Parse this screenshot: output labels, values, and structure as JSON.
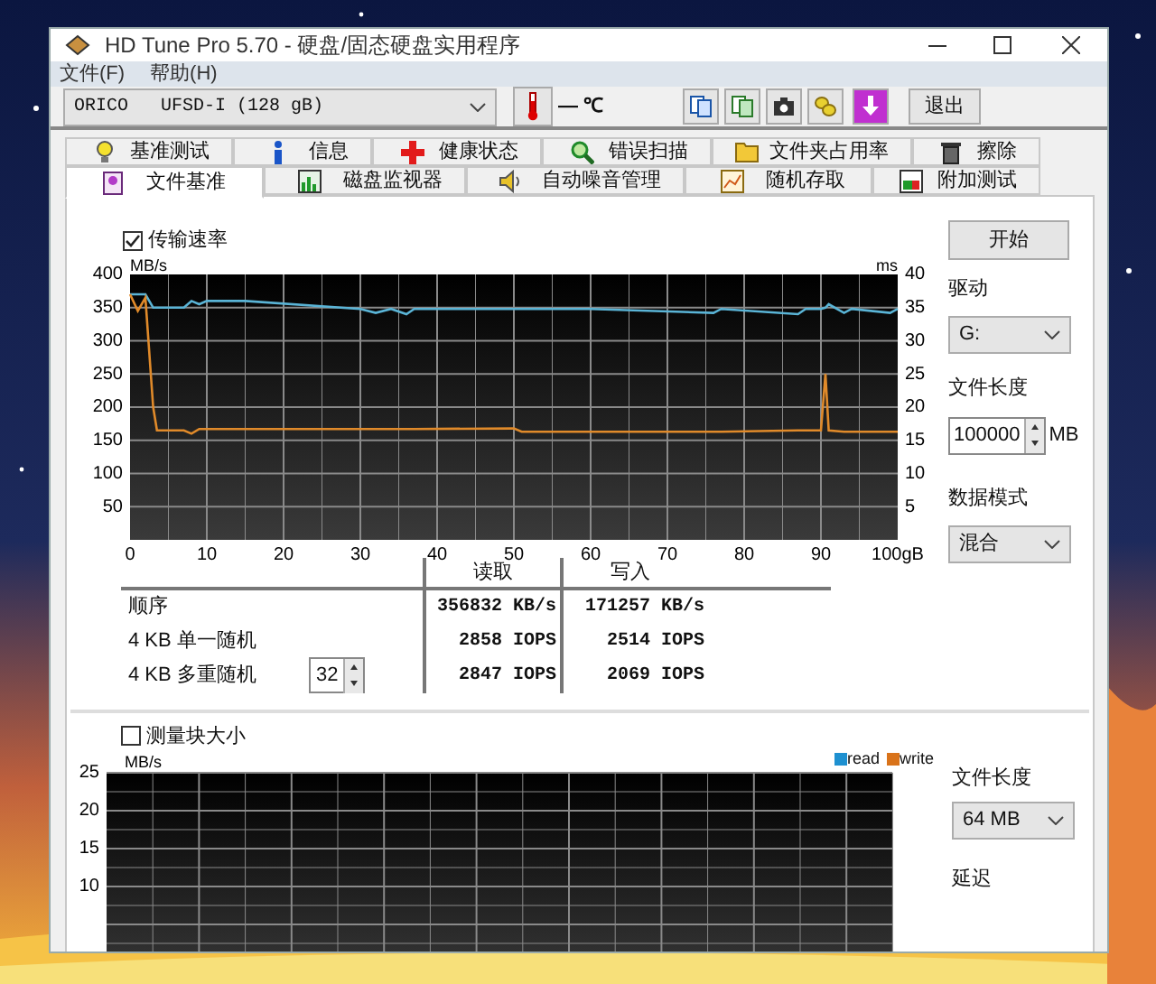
{
  "window": {
    "title": "HD Tune Pro 5.70 - 硬盘/固态硬盘实用程序"
  },
  "menu": [
    "文件(F)",
    "帮助(H)"
  ],
  "toolbar": {
    "drive": "ORICO   UFSD-I (128 gB)",
    "temperature": "— ℃",
    "exit_button": "退出"
  },
  "tabs_row_1": [
    {
      "label": "基准测试",
      "selected": false
    },
    {
      "label": "信息",
      "selected": false
    },
    {
      "label": "健康状态",
      "selected": false
    },
    {
      "label": "错误扫描",
      "selected": false
    },
    {
      "label": "文件夹占用率",
      "selected": false
    },
    {
      "label": "擦除",
      "selected": false
    }
  ],
  "tabs_row_2": [
    {
      "label": "文件基准",
      "selected": true
    },
    {
      "label": "磁盘监视器",
      "selected": false
    },
    {
      "label": "自动噪音管理",
      "selected": false
    },
    {
      "label": "随机存取",
      "selected": false
    },
    {
      "label": "附加测试",
      "selected": false
    }
  ],
  "transfer_rate": {
    "label": "传输速率",
    "checked": true,
    "chart_data": {
      "type": "line",
      "ylabel": "MB/s",
      "x": [
        0,
        1,
        2,
        3,
        3.5,
        7,
        8,
        9,
        10,
        15,
        30,
        32,
        34,
        36,
        37,
        50,
        51,
        60,
        76,
        77,
        87,
        88,
        90,
        90.6,
        91,
        93,
        94,
        99,
        100
      ],
      "series": [
        {
          "color": "#5ab4d6",
          "values": [
            370,
            370,
            370,
            350,
            350,
            350,
            360,
            355,
            360,
            360,
            348,
            342,
            348,
            340,
            348,
            348,
            348,
            348,
            342,
            348,
            340,
            348,
            348,
            350,
            355,
            342,
            348,
            342,
            348
          ]
        },
        {
          "color": "#e08a2a",
          "values": [
            370,
            345,
            365,
            200,
            165,
            165,
            160,
            167,
            167,
            167,
            167,
            167,
            167,
            167,
            167,
            168,
            163,
            163,
            163,
            163,
            165,
            165,
            165,
            250,
            165,
            163,
            163,
            163,
            163
          ]
        }
      ],
      "xlim": [
        0,
        100
      ],
      "ylim": [
        0,
        400
      ],
      "grid": true,
      "xticks": [
        0,
        10,
        20,
        30,
        40,
        50,
        60,
        70,
        80,
        90,
        {
          "value": 100,
          "label": "100gB"
        }
      ],
      "yticks": [
        50,
        100,
        150,
        200,
        250,
        300,
        350,
        400
      ],
      "y2label": "ms",
      "y2lim": [
        0,
        40
      ],
      "y2ticks": [
        5,
        10,
        15,
        20,
        25,
        30,
        35,
        40
      ]
    }
  },
  "results": {
    "columns": [
      "读取",
      "写入"
    ],
    "rows": [
      {
        "label": "顺序",
        "read": "356832 KB/s",
        "write": "171257 KB/s"
      },
      {
        "label": "4 KB 单一随机",
        "read": "2858 IOPS",
        "write": "2514 IOPS"
      },
      {
        "label": "4 KB 多重随机",
        "queue_depth": "32",
        "read": "2847 IOPS",
        "write": "2069 IOPS"
      }
    ]
  },
  "side_panel": {
    "start_button": "开始",
    "drive_label": "驱动",
    "drive": "G:",
    "file_length_label": "文件长度",
    "file_length": "100000",
    "file_length_unit": "MB",
    "data_mode_label": "数据模式",
    "data_mode": "混合"
  },
  "block_size": {
    "label": "测量块大小",
    "checked": false,
    "chart_data": {
      "type": "bar",
      "ylabel": "MB/s",
      "ylim": [
        0,
        25
      ],
      "grid": true,
      "yticks": [
        10,
        15,
        20,
        25
      ],
      "series": [
        {
          "name": "read",
          "color": "#1e90d0"
        },
        {
          "name": "write",
          "color": "#d9731a"
        }
      ]
    }
  },
  "block_side": {
    "file_length_label": "文件长度",
    "file_length": "64 MB",
    "latency_label": "延迟"
  }
}
